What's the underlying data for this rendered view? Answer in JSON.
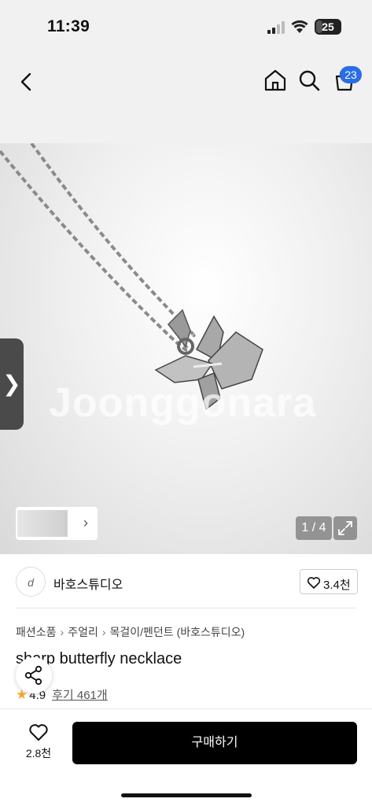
{
  "status_bar": {
    "time": "11:39",
    "battery": "25",
    "battery_level": 0.25
  },
  "header": {
    "cart_badge": "23",
    "icons": [
      "chevron-left-icon",
      "home-icon",
      "search-icon",
      "bag-icon"
    ]
  },
  "gallery": {
    "watermark": "Joonggonara",
    "side_tab": "❯",
    "thumb_arrow": "›",
    "counter": "1 / 4"
  },
  "seller": {
    "avatar": "d",
    "name": "바호스튜디오",
    "favorites": "3.4천"
  },
  "breadcrumb": [
    "패션소품",
    "주얼리",
    "목걸이/펜던트 (바호스튜디오)"
  ],
  "product": {
    "title": "sharp butterfly necklace",
    "rating": "4.9",
    "reviews": "후기 461개"
  },
  "bottom_bar": {
    "likes": "2.8천",
    "buy_label": "구매하기"
  },
  "colors": {
    "badge": "#2a6de6",
    "star": "#f6a623",
    "buy_button": "#000000"
  }
}
